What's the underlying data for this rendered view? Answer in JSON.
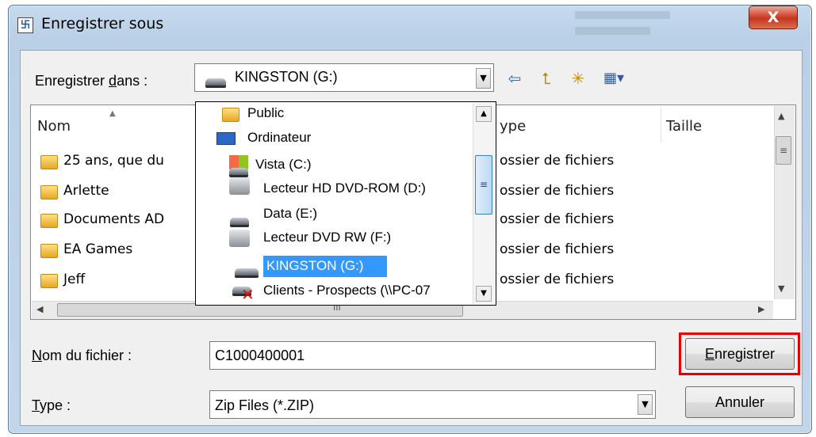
{
  "window": {
    "title": "Enregistrer sous",
    "close_glyph": "X"
  },
  "savein": {
    "label_pre": "Enregistrer ",
    "label_ul": "d",
    "label_post": "ans :",
    "value": "KINGSTON (G:)"
  },
  "toolbar": {
    "back_icon": "back-arrow-icon",
    "up_icon": "up-folder-icon",
    "new_folder_icon": "new-folder-icon",
    "view_icon": "view-menu-icon",
    "back_glyph": "⇦",
    "up_glyph": "⮤",
    "new_folder_glyph": "✳",
    "view_glyph": "▦▾"
  },
  "list": {
    "columns": {
      "name": "Nom",
      "type": "ype",
      "size": "Taille"
    },
    "rows": [
      {
        "name": "25 ans, que du",
        "type": "ossier de fichiers"
      },
      {
        "name": "Arlette",
        "type": "ossier de fichiers"
      },
      {
        "name": "Documents AD",
        "type": "ossier de fichiers"
      },
      {
        "name": "EA Games",
        "type": "ossier de fichiers"
      },
      {
        "name": "Jeff",
        "type": "ossier de fichiers"
      }
    ],
    "hscroll_grip": "III"
  },
  "dropdown": {
    "items": [
      {
        "label": "Public",
        "icon": "folder-icon"
      },
      {
        "label": "Ordinateur",
        "icon": "computer-icon"
      },
      {
        "label": "Vista (C:)",
        "icon": "windows-drive-icon"
      },
      {
        "label": "Lecteur HD DVD-ROM (D:)",
        "icon": "dvd-drive-icon"
      },
      {
        "label": "Data (E:)",
        "icon": "hard-drive-icon"
      },
      {
        "label": "Lecteur DVD RW (F:)",
        "icon": "dvd-drive-icon"
      },
      {
        "label": "KINGSTON (G:)",
        "icon": "usb-drive-icon",
        "selected": true
      },
      {
        "label": "Clients - Prospects (\\\\PC-07",
        "icon": "network-drive-error-icon"
      }
    ]
  },
  "filename": {
    "label_ul": "N",
    "label_post": "om du fichier :",
    "value": "C1000400001"
  },
  "filetype": {
    "label_ul": "T",
    "label_post": "ype :",
    "value": "Zip Files (*.ZIP)"
  },
  "buttons": {
    "save_ul": "E",
    "save_post": "nregistrer",
    "cancel": "Annuler"
  },
  "colors": {
    "selection": "#3399ff",
    "highlight_border": "#e60000",
    "titlebar": "#c6daed"
  }
}
